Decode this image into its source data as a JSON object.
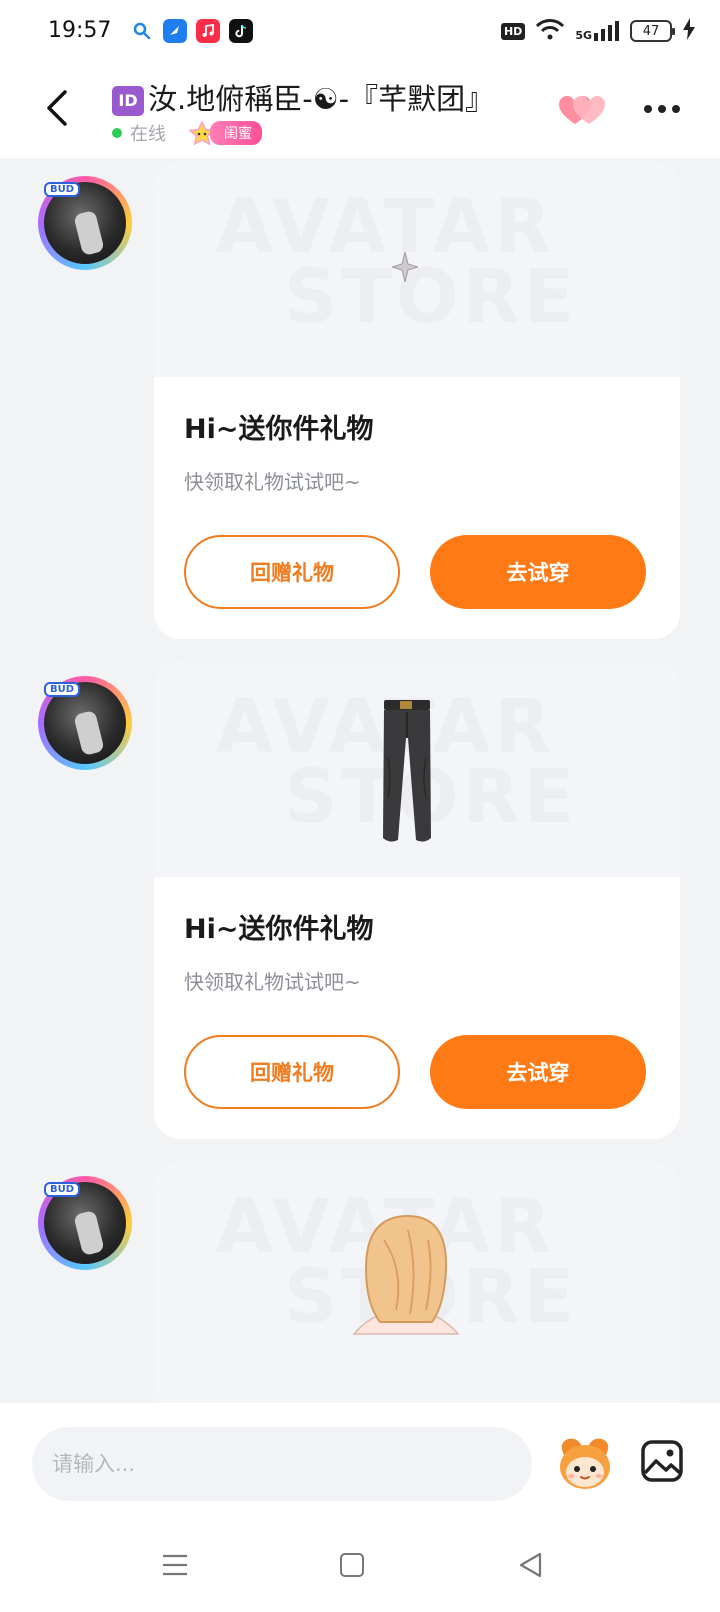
{
  "status_bar": {
    "time": "19:57",
    "hd_label": "HD",
    "network_label": "5G",
    "battery_level": "47",
    "app_icons": [
      "search-app-icon",
      "browser-app-icon",
      "music-app-icon",
      "tiktok-app-icon"
    ]
  },
  "header": {
    "id_badge": "ID",
    "title": "汝.地俯稱臣-☯-『芊默团』",
    "online_status": "在线",
    "relation_tag": "闺蜜",
    "colors": {
      "online": "#2ecc55",
      "tag": "#ff4f96"
    }
  },
  "messages": [
    {
      "avatar_tag": "BUD",
      "watermark_top": "AVATAR",
      "watermark_bottom": "STORE",
      "item": "sparkle",
      "title": "Hi~送你件礼物",
      "subtitle": "快领取礼物试试吧~",
      "return_gift_label": "回赠礼物",
      "try_on_label": "去试穿"
    },
    {
      "avatar_tag": "BUD",
      "watermark_top": "AVATAR",
      "watermark_bottom": "STORE",
      "item": "trousers",
      "title": "Hi~送你件礼物",
      "subtitle": "快领取礼物试试吧~",
      "return_gift_label": "回赠礼物",
      "try_on_label": "去试穿"
    },
    {
      "avatar_tag": "BUD",
      "watermark_top": "AVATAR",
      "watermark_bottom": "STORE",
      "item": "hair"
    }
  ],
  "input_bar": {
    "placeholder": "请输入..."
  },
  "theme": {
    "accent": "#ff7a14",
    "accent_outline": "#f07c20"
  }
}
